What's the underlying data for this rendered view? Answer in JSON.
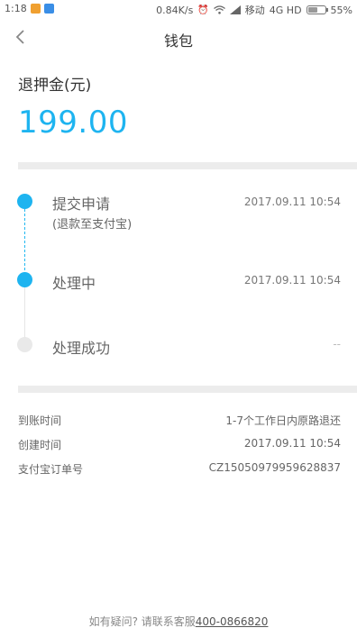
{
  "status_bar": {
    "time": "1:18",
    "speed": "0.84K/s",
    "carrier": "移动",
    "network": "4G HD",
    "battery": "55%",
    "battery_level": 0.55
  },
  "header": {
    "title": "钱包"
  },
  "refund": {
    "label": "退押金(元)",
    "amount": "199.00",
    "accent_color": "#1eb4f0"
  },
  "timeline": [
    {
      "label": "提交申请",
      "sub": "(退款至支付宝)",
      "time": "2017.09.11 10:54",
      "state": "done"
    },
    {
      "label": "处理中",
      "sub": "",
      "time": "2017.09.11 10:54",
      "state": "done"
    },
    {
      "label": "处理成功",
      "sub": "",
      "time": "--",
      "state": "pending"
    }
  ],
  "details": [
    {
      "key": "到账时间",
      "value": "1-7个工作日内原路退还"
    },
    {
      "key": "创建时间",
      "value": "2017.09.11 10:54"
    },
    {
      "key": "支付宝订单号",
      "value": "CZ150509799596288​37"
    }
  ],
  "footer": {
    "text": "如有疑问? 请联系客服",
    "phone": "400-0866820"
  }
}
